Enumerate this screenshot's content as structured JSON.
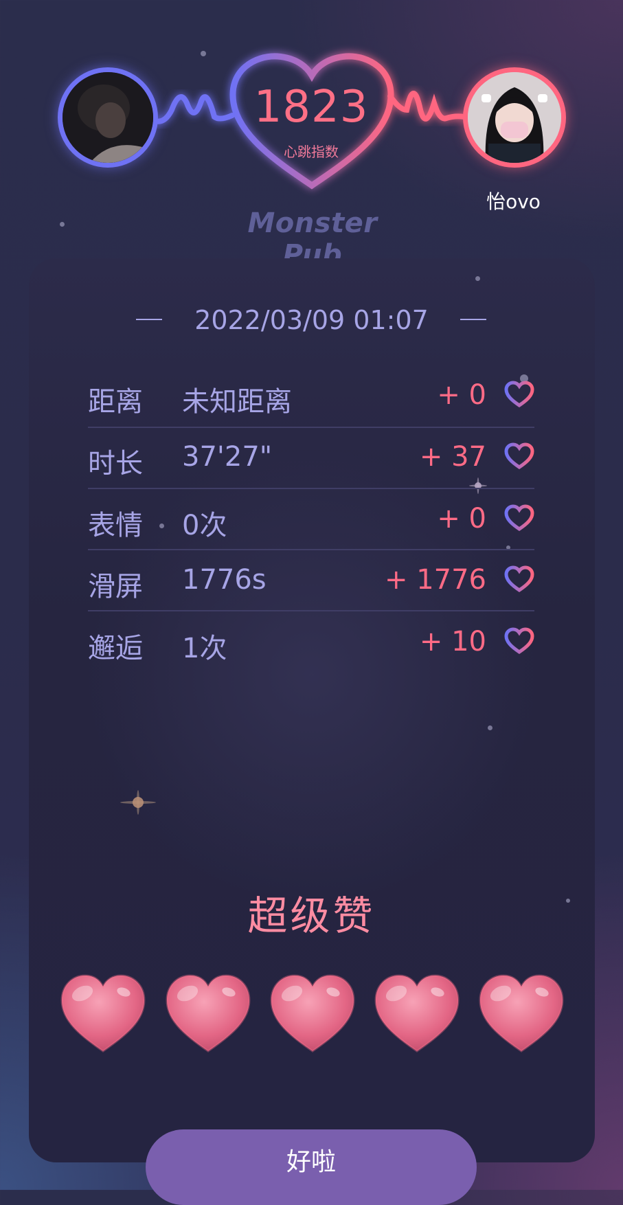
{
  "header": {
    "score": "1823",
    "score_label": "心跳指数",
    "brand": "Monster Pub",
    "left_user": {
      "avatar": "dark-portrait-avatar",
      "ring_color": "#6f72f4"
    },
    "right_user": {
      "name": "怡ovo",
      "avatar": "masked-girl-avatar",
      "ring_color": "#ff6680"
    }
  },
  "card": {
    "datetime": "2022/03/09 01:07",
    "rows": [
      {
        "label": "距离",
        "value": "未知距离",
        "score": "+ 0"
      },
      {
        "label": "时长",
        "value": "37'27\"",
        "score": "+ 37"
      },
      {
        "label": "表情",
        "value": "0次",
        "score": "+ 0"
      },
      {
        "label": "滑屏",
        "value": "1776s",
        "score": "+ 1776"
      },
      {
        "label": "邂逅",
        "value": "1次",
        "score": "+ 10"
      }
    ],
    "row_icon": "heart-outline-icon",
    "rating_title": "超级赞",
    "rating": {
      "filled_hearts": 5,
      "max_hearts": 5,
      "icon": "glossy-heart-icon"
    }
  },
  "footer": {
    "ok_label": "好啦"
  },
  "colors": {
    "accent_blue": "#6f72f4",
    "accent_pink": "#ff6680",
    "text_lavender": "#a7a5e6",
    "button": "#7a5fae"
  }
}
